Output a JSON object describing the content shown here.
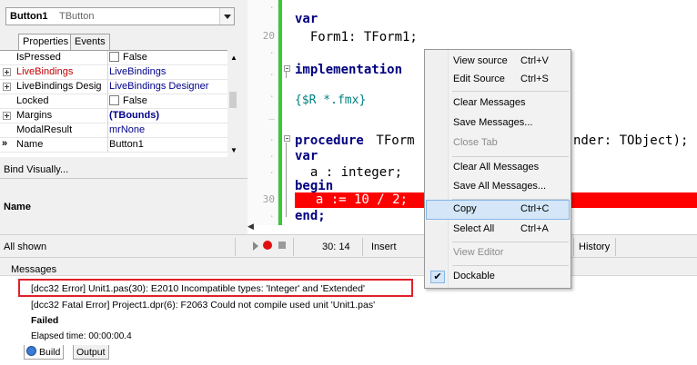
{
  "object_inspector": {
    "component_name": "Button1",
    "component_type": "TButton",
    "tabs": [
      {
        "label": "Properties"
      },
      {
        "label": "Events"
      }
    ],
    "properties": [
      {
        "name": "IsPressed",
        "value": "False"
      },
      {
        "name": "LiveBindings",
        "value": "LiveBindings"
      },
      {
        "name": "LiveBindings Desig",
        "value": "LiveBindings Designer"
      },
      {
        "name": "Locked",
        "value": "False"
      },
      {
        "name": "Margins",
        "value": "(TBounds)"
      },
      {
        "name": "ModalResult",
        "value": "mrNone"
      },
      {
        "name": "Name",
        "value": "Button1"
      }
    ],
    "bind_visually": "Bind Visually...",
    "description_title": "Name"
  },
  "editor": {
    "gutter": [
      "20",
      "30"
    ],
    "lines": {
      "var1": "var",
      "form_decl": "  Form1: TForm1;",
      "implementation": "implementation",
      "directive": "{$R *.fmx}",
      "proc_kw": "procedure",
      "proc_name": " TForm",
      "proc_tail": "nder: TObject);",
      "var2": "var",
      "decl_a": "  a : integer;",
      "begin": "begin",
      "error_line": "  a := 10 / 2;",
      "end": "end;"
    }
  },
  "status_bar": {
    "filter": "All shown",
    "cursor_pos": "30: 14",
    "mode": "Insert",
    "history_tab": "History"
  },
  "messages": {
    "title": "Messages",
    "items": [
      "[dcc32 Error] Unit1.pas(30): E2010 Incompatible types: 'Integer' and 'Extended'",
      "[dcc32 Fatal Error] Project1.dpr(6): F2063 Could not compile used unit 'Unit1.pas'",
      "Failed",
      "Elapsed time: 00:00:00.4"
    ],
    "tabs": [
      {
        "label": "Build"
      },
      {
        "label": "Output"
      }
    ]
  },
  "context_menu": {
    "items": [
      {
        "label": "View source",
        "shortcut": "Ctrl+V"
      },
      {
        "label": "Edit Source",
        "shortcut": "Ctrl+S"
      },
      {
        "label": "Clear Messages"
      },
      {
        "label": "Save Messages..."
      },
      {
        "label": "Close Tab"
      },
      {
        "label": "Clear All Messages"
      },
      {
        "label": "Save All Messages..."
      },
      {
        "label": "Copy",
        "shortcut": "Ctrl+C"
      },
      {
        "label": "Select All",
        "shortcut": "Ctrl+A"
      },
      {
        "label": "View Editor"
      },
      {
        "label": "Dockable"
      }
    ],
    "highlighted": "Copy",
    "checked": "Dockable"
  },
  "colors": {
    "error_line_bg": "#ff0000",
    "highlight_box": "#e0202a",
    "change_bar": "#3cc83c",
    "menu_highlight": "#d4e6f8"
  }
}
